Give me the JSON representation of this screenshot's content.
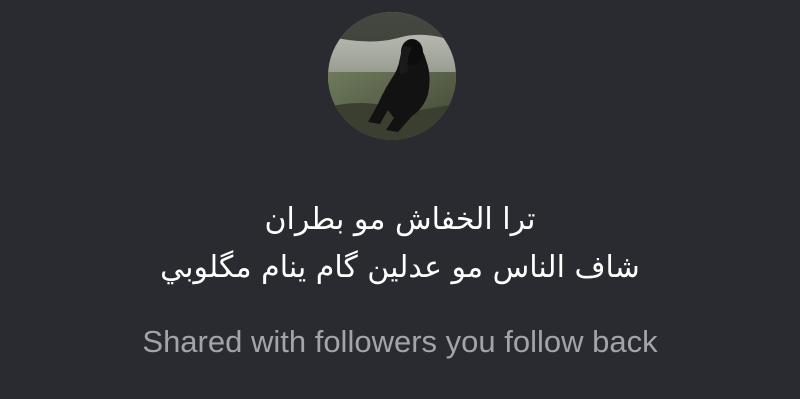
{
  "note": {
    "lines": [
      "ترا الخفاش مو بطران",
      "شاف الناس مو عدلين گام ينام مگلوبي"
    ]
  },
  "audience_label": "Shared with followers you follow back",
  "colors": {
    "background": "#2a2b30",
    "note_text": "#ffffff",
    "audience_text": "#a3a4ab"
  },
  "avatar": {
    "icon": "profile-photo"
  }
}
